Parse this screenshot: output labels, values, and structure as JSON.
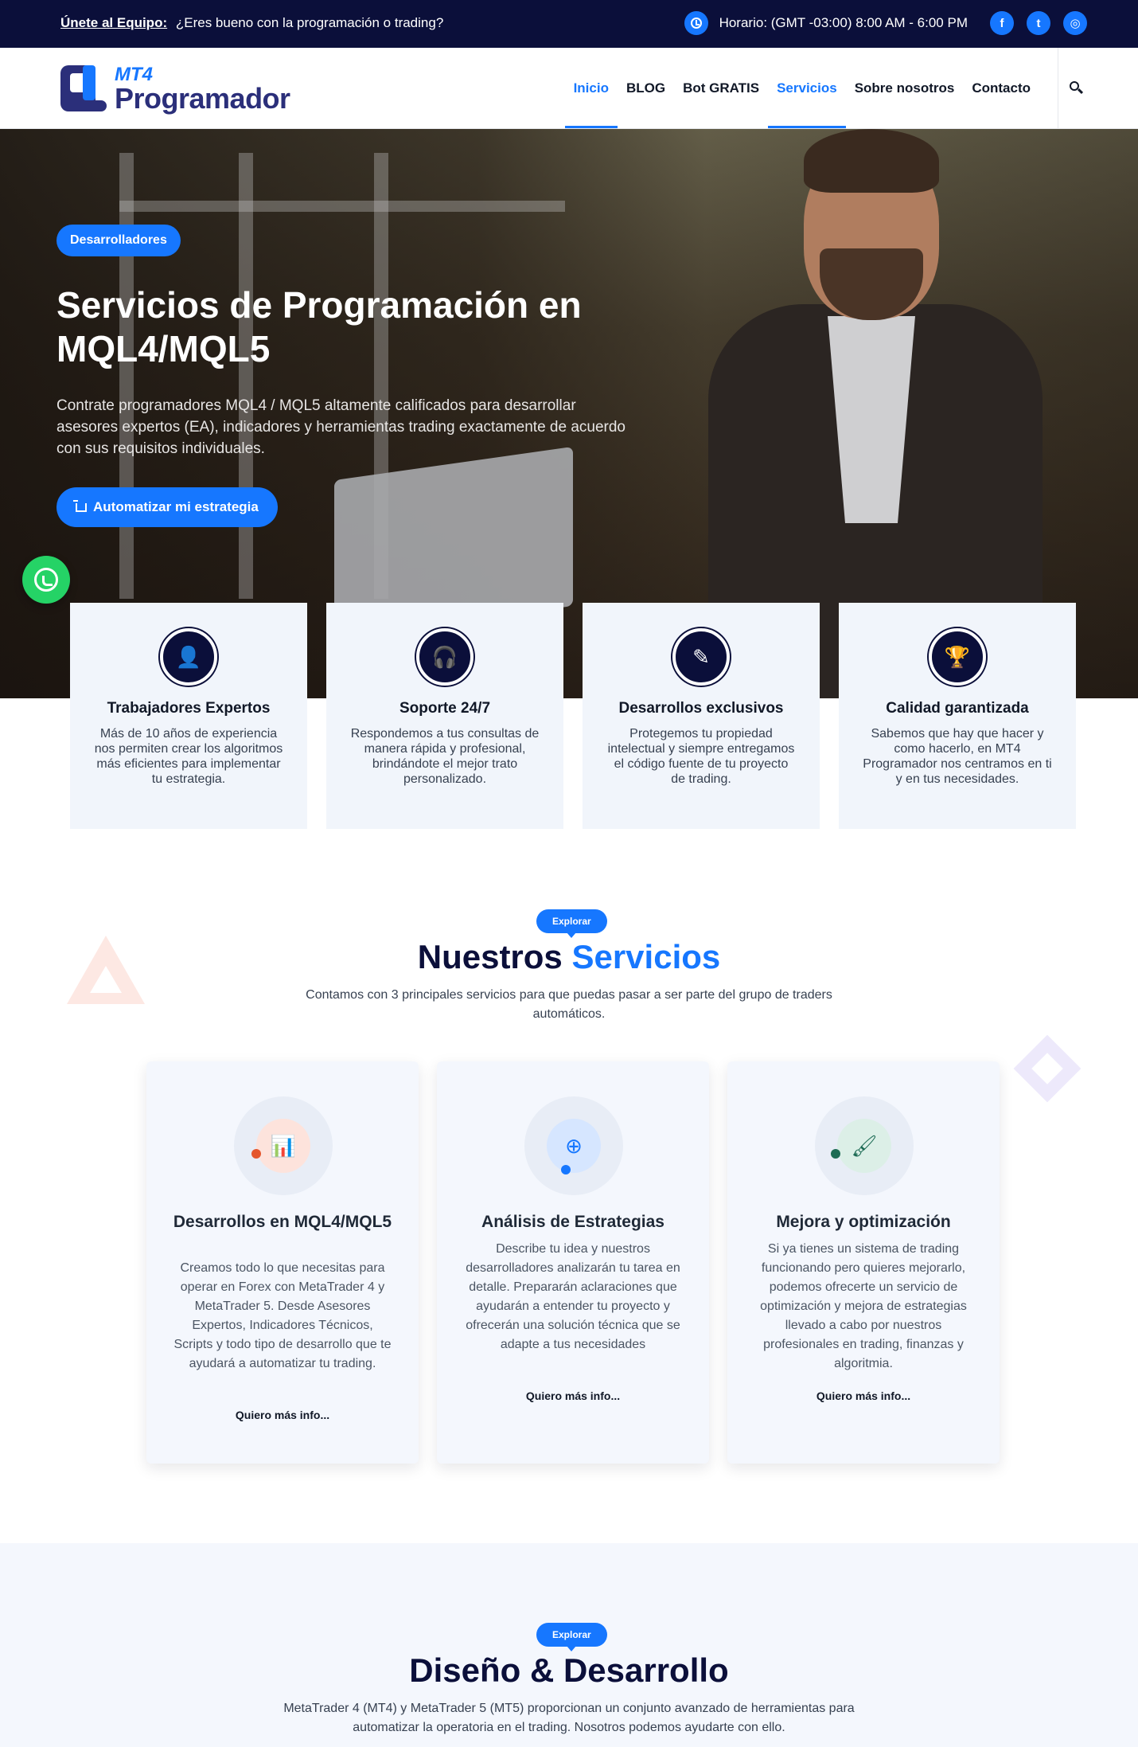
{
  "topbar": {
    "join_label": "Únete al Equipo:",
    "join_text": "¿Eres bueno con la programación o trading?",
    "hours": "Horario: (GMT -03:00) 8:00 AM - 6:00 PM",
    "social": [
      {
        "icon": "facebook-icon",
        "glyph": "f"
      },
      {
        "icon": "twitter-icon",
        "glyph": "t"
      },
      {
        "icon": "instagram-icon",
        "glyph": "◎"
      }
    ]
  },
  "header": {
    "logo_mt4": "MT4",
    "logo_name": "Programador",
    "nav": [
      "Inicio",
      "BLOG",
      "Bot GRATIS",
      "Servicios",
      "Sobre nosotros",
      "Contacto"
    ],
    "active_nav": [
      "Inicio",
      "Servicios"
    ]
  },
  "hero": {
    "badge": "Desarrolladores",
    "title": "Servicios de Programación en MQL4/MQL5",
    "description": "Contrate programadores MQL4 / MQL5 altamente calificados para desarrollar asesores expertos (EA), indicadores y herramientas trading exactamente de acuerdo con sus requisitos individuales.",
    "cta": "Automatizar mi estrategia"
  },
  "features": [
    {
      "icon": "user-icon",
      "glyph": "👤",
      "title": "Trabajadores Expertos",
      "desc": "Más de 10 años de experiencia nos permiten crear los algoritmos más eficientes para implementar tu estrategia."
    },
    {
      "icon": "headset-icon",
      "glyph": "🎧",
      "title": "Soporte 24/7",
      "desc": "Respondemos a tus consultas de manera rápida y profesional, brindándote el mejor trato personalizado."
    },
    {
      "icon": "edit-icon",
      "glyph": "✎",
      "title": "Desarrollos exclusivos",
      "desc": "Protegemos tu propiedad intelectual y siempre entregamos el código fuente de tu proyecto de trading."
    },
    {
      "icon": "trophy-icon",
      "glyph": "🏆",
      "title": "Calidad garantizada",
      "desc": "Sabemos que hay que hacer y como hacerlo, en MT4 Programador nos centramos en ti y en tus necesidades."
    }
  ],
  "services_section": {
    "explore": "Explorar",
    "title_a": "Nuestros",
    "title_b": "Servicios",
    "subtitle": "Contamos con 3 principales servicios para que puedas pasar a ser parte del grupo de traders automáticos.",
    "cards": [
      {
        "icon": "bar-chart-icon",
        "glyph": "📊",
        "title": "Desarrollos en MQL4/MQL5",
        "desc": "Creamos todo lo que necesitas para operar en Forex con MetaTrader 4 y MetaTrader 5. Desde Asesores Expertos, Indicadores Técnicos, Scripts y todo tipo de desarrollo que te ayudará a automatizar tu trading.",
        "link": "Quiero más info..."
      },
      {
        "icon": "lifebuoy-icon",
        "glyph": "⊕",
        "title": "Análisis de Estrategias",
        "desc": "Describe tu idea y nuestros desarrolladores analizarán tu tarea en detalle. Prepararán aclaraciones que ayudarán a entender tu proyecto y ofrecerán una solución técnica que se adapte a tus necesidades",
        "link": "Quiero más info..."
      },
      {
        "icon": "brush-icon",
        "glyph": "🖌",
        "title": "Mejora y optimización",
        "desc": "Si ya tienes un sistema de trading funcionando pero quieres mejorarlo, podemos ofrecerte un servicio de optimización y mejora de estrategias llevado a cabo por nuestros profesionales en trading, finanzas y algoritmia.",
        "link": "Quiero más info..."
      }
    ]
  },
  "design_section": {
    "explore": "Explorar",
    "title": "Diseño & Desarrollo",
    "subtitle": "MetaTrader 4 (MT4) y MetaTrader 5 (MT5) proporcionan un conjunto avanzado de herramientas para automatizar la operatoria en el trading. Nosotros podemos ayudarte con ello."
  },
  "colors": {
    "navy": "#0b0f3a",
    "accent": "#1677ff",
    "whatsapp": "#25d366"
  }
}
